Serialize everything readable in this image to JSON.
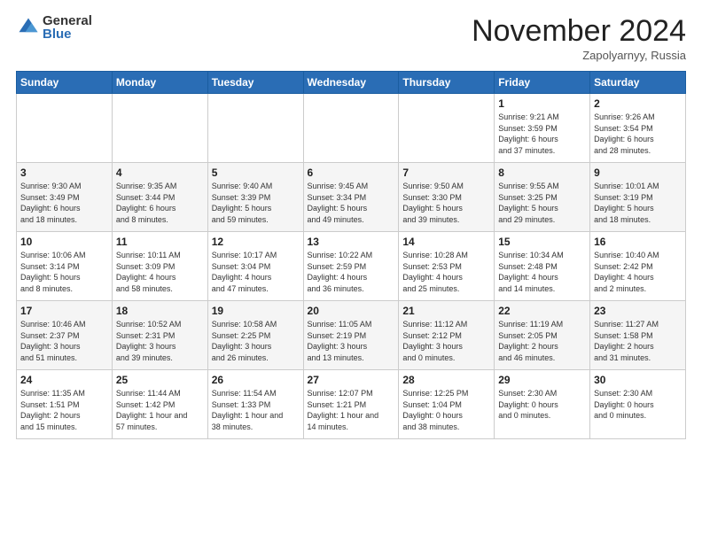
{
  "logo": {
    "general": "General",
    "blue": "Blue"
  },
  "title": "November 2024",
  "location": "Zapolyarnyy, Russia",
  "weekdays": [
    "Sunday",
    "Monday",
    "Tuesday",
    "Wednesday",
    "Thursday",
    "Friday",
    "Saturday"
  ],
  "weeks": [
    [
      {
        "day": "",
        "info": ""
      },
      {
        "day": "",
        "info": ""
      },
      {
        "day": "",
        "info": ""
      },
      {
        "day": "",
        "info": ""
      },
      {
        "day": "",
        "info": ""
      },
      {
        "day": "1",
        "info": "Sunrise: 9:21 AM\nSunset: 3:59 PM\nDaylight: 6 hours\nand 37 minutes."
      },
      {
        "day": "2",
        "info": "Sunrise: 9:26 AM\nSunset: 3:54 PM\nDaylight: 6 hours\nand 28 minutes."
      }
    ],
    [
      {
        "day": "3",
        "info": "Sunrise: 9:30 AM\nSunset: 3:49 PM\nDaylight: 6 hours\nand 18 minutes."
      },
      {
        "day": "4",
        "info": "Sunrise: 9:35 AM\nSunset: 3:44 PM\nDaylight: 6 hours\nand 8 minutes."
      },
      {
        "day": "5",
        "info": "Sunrise: 9:40 AM\nSunset: 3:39 PM\nDaylight: 5 hours\nand 59 minutes."
      },
      {
        "day": "6",
        "info": "Sunrise: 9:45 AM\nSunset: 3:34 PM\nDaylight: 5 hours\nand 49 minutes."
      },
      {
        "day": "7",
        "info": "Sunrise: 9:50 AM\nSunset: 3:30 PM\nDaylight: 5 hours\nand 39 minutes."
      },
      {
        "day": "8",
        "info": "Sunrise: 9:55 AM\nSunset: 3:25 PM\nDaylight: 5 hours\nand 29 minutes."
      },
      {
        "day": "9",
        "info": "Sunrise: 10:01 AM\nSunset: 3:19 PM\nDaylight: 5 hours\nand 18 minutes."
      }
    ],
    [
      {
        "day": "10",
        "info": "Sunrise: 10:06 AM\nSunset: 3:14 PM\nDaylight: 5 hours\nand 8 minutes."
      },
      {
        "day": "11",
        "info": "Sunrise: 10:11 AM\nSunset: 3:09 PM\nDaylight: 4 hours\nand 58 minutes."
      },
      {
        "day": "12",
        "info": "Sunrise: 10:17 AM\nSunset: 3:04 PM\nDaylight: 4 hours\nand 47 minutes."
      },
      {
        "day": "13",
        "info": "Sunrise: 10:22 AM\nSunset: 2:59 PM\nDaylight: 4 hours\nand 36 minutes."
      },
      {
        "day": "14",
        "info": "Sunrise: 10:28 AM\nSunset: 2:53 PM\nDaylight: 4 hours\nand 25 minutes."
      },
      {
        "day": "15",
        "info": "Sunrise: 10:34 AM\nSunset: 2:48 PM\nDaylight: 4 hours\nand 14 minutes."
      },
      {
        "day": "16",
        "info": "Sunrise: 10:40 AM\nSunset: 2:42 PM\nDaylight: 4 hours\nand 2 minutes."
      }
    ],
    [
      {
        "day": "17",
        "info": "Sunrise: 10:46 AM\nSunset: 2:37 PM\nDaylight: 3 hours\nand 51 minutes."
      },
      {
        "day": "18",
        "info": "Sunrise: 10:52 AM\nSunset: 2:31 PM\nDaylight: 3 hours\nand 39 minutes."
      },
      {
        "day": "19",
        "info": "Sunrise: 10:58 AM\nSunset: 2:25 PM\nDaylight: 3 hours\nand 26 minutes."
      },
      {
        "day": "20",
        "info": "Sunrise: 11:05 AM\nSunset: 2:19 PM\nDaylight: 3 hours\nand 13 minutes."
      },
      {
        "day": "21",
        "info": "Sunrise: 11:12 AM\nSunset: 2:12 PM\nDaylight: 3 hours\nand 0 minutes."
      },
      {
        "day": "22",
        "info": "Sunrise: 11:19 AM\nSunset: 2:05 PM\nDaylight: 2 hours\nand 46 minutes."
      },
      {
        "day": "23",
        "info": "Sunrise: 11:27 AM\nSunset: 1:58 PM\nDaylight: 2 hours\nand 31 minutes."
      }
    ],
    [
      {
        "day": "24",
        "info": "Sunrise: 11:35 AM\nSunset: 1:51 PM\nDaylight: 2 hours\nand 15 minutes."
      },
      {
        "day": "25",
        "info": "Sunrise: 11:44 AM\nSunset: 1:42 PM\nDaylight: 1 hour and\n57 minutes."
      },
      {
        "day": "26",
        "info": "Sunrise: 11:54 AM\nSunset: 1:33 PM\nDaylight: 1 hour and\n38 minutes."
      },
      {
        "day": "27",
        "info": "Sunrise: 12:07 PM\nSunset: 1:21 PM\nDaylight: 1 hour and\n14 minutes."
      },
      {
        "day": "28",
        "info": "Sunrise: 12:25 PM\nSunset: 1:04 PM\nDaylight: 0 hours\nand 38 minutes."
      },
      {
        "day": "29",
        "info": "Sunset: 2:30 AM\nDaylight: 0 hours\nand 0 minutes."
      },
      {
        "day": "30",
        "info": "Sunset: 2:30 AM\nDaylight: 0 hours\nand 0 minutes."
      }
    ]
  ]
}
